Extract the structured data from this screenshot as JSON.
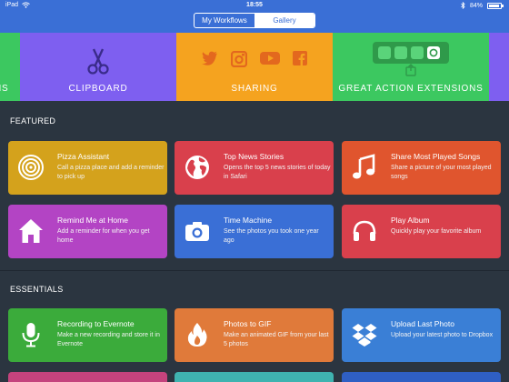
{
  "status": {
    "device": "iPad",
    "time": "18:55",
    "battery": "84%"
  },
  "nav": {
    "tabs": [
      {
        "label": "My Workflows",
        "selected": false
      },
      {
        "label": "Gallery",
        "selected": true
      }
    ]
  },
  "categories": [
    {
      "label": "NS",
      "color": "#3cc860"
    },
    {
      "label": "CLIPBOARD",
      "color": "#7e5ff0"
    },
    {
      "label": "SHARING",
      "color": "#f5a31f"
    },
    {
      "label": "GREAT ACTION EXTENSIONS",
      "color": "#3cc860"
    },
    {
      "label": "",
      "color": "#7e5ff0"
    }
  ],
  "featured": {
    "title": "FEATURED",
    "cards": [
      {
        "title": "Pizza Assistant",
        "desc": "Call a pizza place and add a reminder to pick up",
        "color": "#d4a21c",
        "icon": "target-icon"
      },
      {
        "title": "Top News Stories",
        "desc": "Opens the top 5 news stories of today in Safari",
        "color": "#d9404c",
        "icon": "globe-icon"
      },
      {
        "title": "Share Most Played Songs",
        "desc": "Share a picture of your most played songs",
        "color": "#e0552e",
        "icon": "music-note-icon"
      },
      {
        "title": "Remind Me at Home",
        "desc": "Add a reminder for when you get home",
        "color": "#b344c4",
        "icon": "home-icon"
      },
      {
        "title": "Time Machine",
        "desc": "See the photos you took one year ago",
        "color": "#3a6fd6",
        "icon": "camera-icon"
      },
      {
        "title": "Play Album",
        "desc": "Quickly play your favorite album",
        "color": "#d9404c",
        "icon": "headphones-icon"
      }
    ]
  },
  "essentials": {
    "title": "ESSENTIALS",
    "cards": [
      {
        "title": "Recording to Evernote",
        "desc": "Make a new recording and store it in Evernote",
        "color": "#3bab3b",
        "icon": "microphone-icon"
      },
      {
        "title": "Photos to GIF",
        "desc": "Make an animated GIF from your last 5 photos",
        "color": "#e07a3a",
        "icon": "flame-icon"
      },
      {
        "title": "Upload Last Photo",
        "desc": "Upload your latest photo to Dropbox",
        "color": "#3a7fd6",
        "icon": "dropbox-icon"
      }
    ],
    "partial_colors": [
      "#c4437d",
      "#3fb3b0",
      "#2f5fc4"
    ]
  }
}
